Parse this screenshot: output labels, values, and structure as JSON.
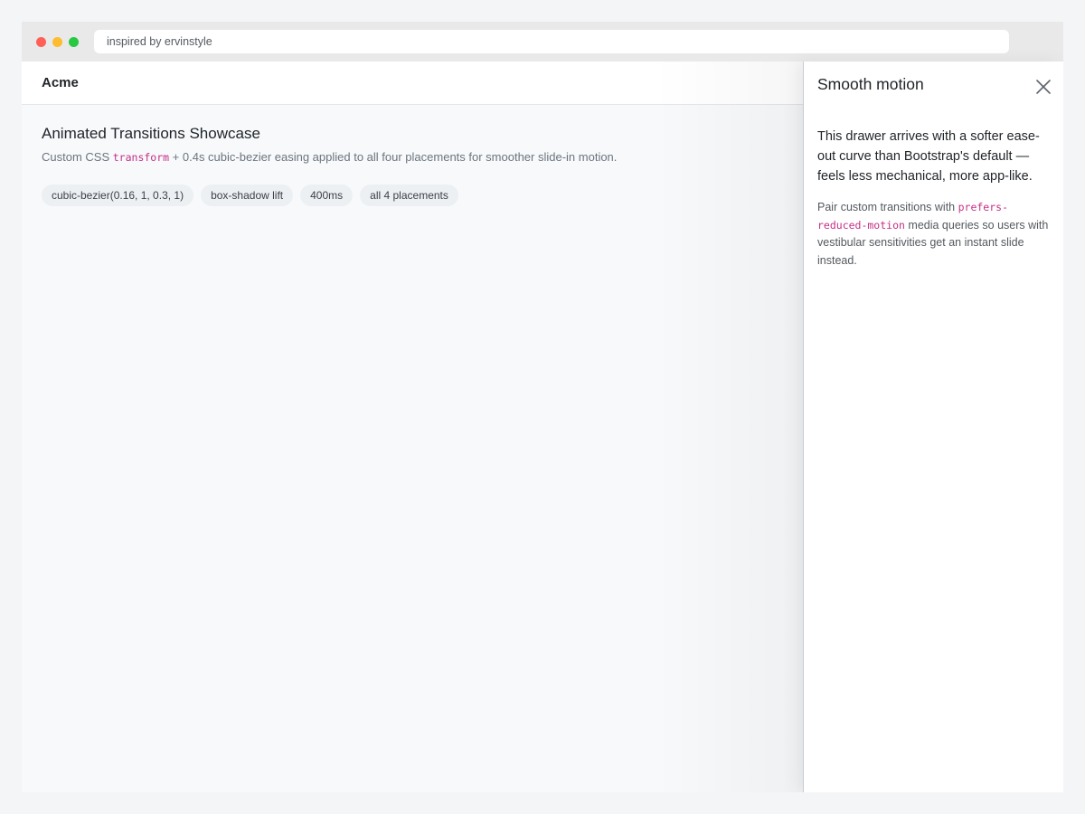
{
  "browser": {
    "url": "inspired by ervinstyle",
    "colors": {
      "close": "#ff5f57",
      "minimize": "#febc2e",
      "zoom": "#28c840"
    }
  },
  "navbar": {
    "brand": "Acme"
  },
  "main": {
    "title": "Animated Transitions Showcase",
    "desc_before": "Custom CSS ",
    "desc_code": "transform",
    "desc_after": " + 0.4s cubic-bezier easing applied to all four placements for smoother slide-in motion.",
    "chips": [
      "cubic-bezier(0.16, 1, 0.3, 1)",
      "box-shadow lift",
      "400ms",
      "all 4 placements"
    ]
  },
  "drawer": {
    "title": "Smooth motion",
    "close_icon": "close-icon",
    "lead": "This drawer arrives with a softer ease-out curve than Bootstrap's default — feels less mechanical, more app-like.",
    "note_before": "Pair custom transitions with ",
    "note_code": "prefers-reduced-motion",
    "note_after": " media queries so users with vestibular sensitivities get an instant slide instead."
  },
  "colors": {
    "code": "#c62f86",
    "page_bg": "#f7f9fb",
    "chip_bg": "#edf0f3"
  }
}
